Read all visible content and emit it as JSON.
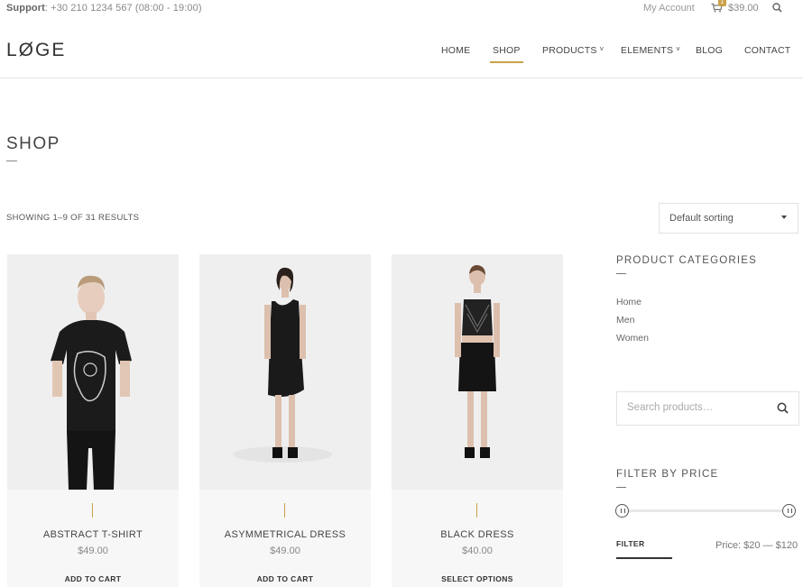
{
  "topbar": {
    "support_label": "Support",
    "support_text": ": +30 210 1234 567 (08:00 - 19:00)",
    "account": "My Account",
    "cart_count": "1",
    "cart_total": "$39.00"
  },
  "header": {
    "logo": "LØGE",
    "nav": [
      {
        "label": "HOME"
      },
      {
        "label": "SHOP"
      },
      {
        "label": "PRODUCTS"
      },
      {
        "label": "ELEMENTS"
      },
      {
        "label": "BLOG"
      },
      {
        "label": "CONTACT"
      }
    ]
  },
  "page": {
    "title": "SHOP",
    "results": "SHOWING 1–9 OF 31 RESULTS",
    "sort_selected": "Default sorting"
  },
  "products": [
    {
      "name": "ABSTRACT T-SHIRT",
      "price": "$49.00",
      "action": "ADD TO CART"
    },
    {
      "name": "ASYMMETRICAL DRESS",
      "price": "$49.00",
      "action": "ADD TO CART"
    },
    {
      "name": "BLACK DRESS",
      "price": "$40.00",
      "action": "SELECT OPTIONS"
    }
  ],
  "sidebar": {
    "categories_title": "PRODUCT CATEGORIES",
    "categories": [
      "Home",
      "Men",
      "Women"
    ],
    "search_placeholder": "Search products…",
    "filter_title": "FILTER BY PRICE",
    "filter_button": "FILTER",
    "price_range": "Price: $20 — $120",
    "price_slider": {
      "min": 20,
      "max": 120
    }
  },
  "colors": {
    "accent": "#c9a24a",
    "text": "#333333",
    "card_bg": "#f7f7f7"
  }
}
